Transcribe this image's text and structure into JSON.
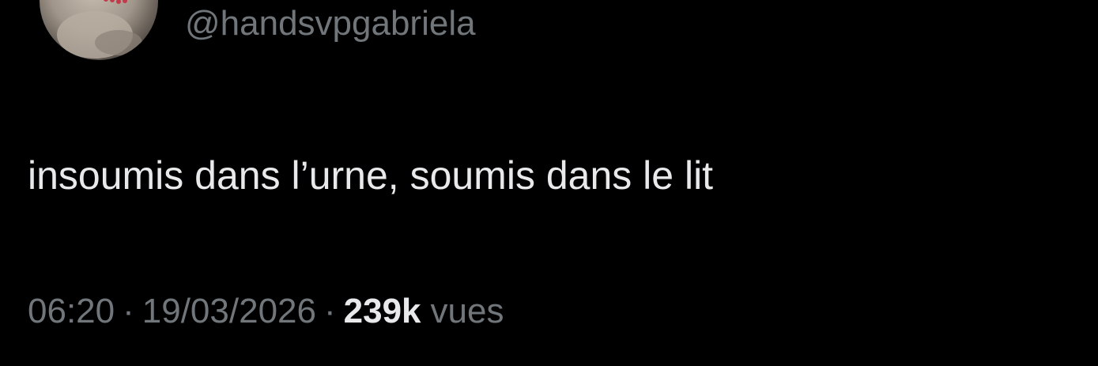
{
  "profile": {
    "handle": "@handsvpgabriela",
    "avatar_icon": "profile-photo"
  },
  "tweet": {
    "text": "insoumis dans l’urne, soumis dans le lit"
  },
  "meta": {
    "time": "06:20",
    "separator": "·",
    "date": "19/03/2026",
    "views_count": "239k",
    "views_label": "vues"
  },
  "colors": {
    "background": "#000000",
    "primary_text": "#e7e9ea",
    "secondary_text": "#71767b"
  }
}
